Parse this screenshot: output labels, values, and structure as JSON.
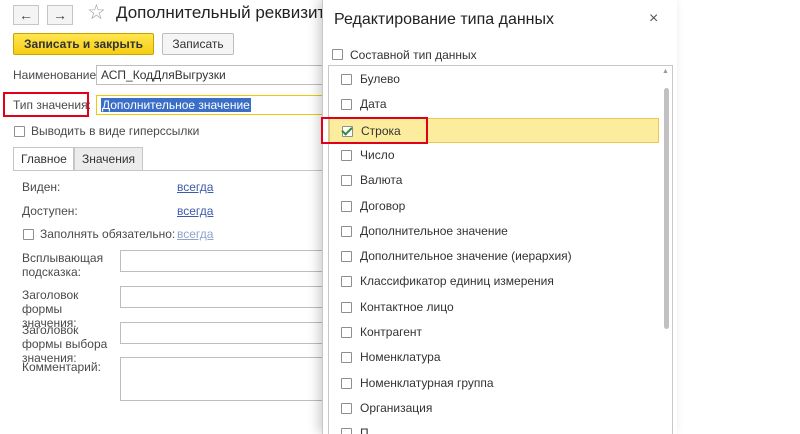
{
  "form": {
    "nav": {
      "back_icon": "arrow-left",
      "forward_icon": "arrow-right",
      "back_glyph": "←",
      "forward_glyph": "→"
    },
    "favorite_icon": "star-outline",
    "favorite_glyph": "☆",
    "title": "Дополнительный реквизит",
    "toolbar": {
      "save_close_label": "Записать и закрыть",
      "save_label": "Записать"
    },
    "name_label": "Наименование:",
    "name_value": "АСП_КодДляВыгрузки",
    "type_label": "Тип значения:",
    "type_value": "Дополнительное значение",
    "hyperlink_label": "Выводить в виде гиперссылки",
    "tabs": [
      {
        "label": "Главное",
        "active": true
      },
      {
        "label": "Значения",
        "active": false
      }
    ],
    "visible_label": "Виден:",
    "visible_value": "всегда",
    "available_label": "Доступен:",
    "available_value": "всегда",
    "required_label": "Заполнять обязательно:",
    "required_value": "всегда",
    "tooltip_label": "Всплывающая подсказка:",
    "form_title_label": "Заголовок формы значения:",
    "select_form_title_label": "Заголовок формы выбора значения:",
    "comment_label": "Комментарий:"
  },
  "dialog": {
    "title": "Редактирование типа данных",
    "close_icon": "close",
    "close_glyph": "×",
    "composite_label": "Составной тип данных",
    "scroll_up_glyph": "▲",
    "types": [
      {
        "label": "Булево",
        "checked": false
      },
      {
        "label": "Дата",
        "checked": false
      },
      {
        "label": "Строка",
        "checked": true
      },
      {
        "label": "Число",
        "checked": false
      },
      {
        "label": "Валюта",
        "checked": false
      },
      {
        "label": "Договор",
        "checked": false
      },
      {
        "label": "Дополнительное значение",
        "checked": false
      },
      {
        "label": "Дополнительное значение (иерархия)",
        "checked": false
      },
      {
        "label": "Классификатор единиц измерения",
        "checked": false
      },
      {
        "label": "Контактное лицо",
        "checked": false
      },
      {
        "label": "Контрагент",
        "checked": false
      },
      {
        "label": "Номенклатура",
        "checked": false
      },
      {
        "label": "Номенклатурная группа",
        "checked": false
      },
      {
        "label": "Организация",
        "checked": false
      },
      {
        "label": "П",
        "checked": false
      }
    ]
  },
  "colors": {
    "accent_yellow": "#f5cd14",
    "selection_blue": "#3b6fc7",
    "highlight_row": "#fcec9d",
    "annotation_red": "#e0001a",
    "link_blue": "#3b5bab"
  }
}
